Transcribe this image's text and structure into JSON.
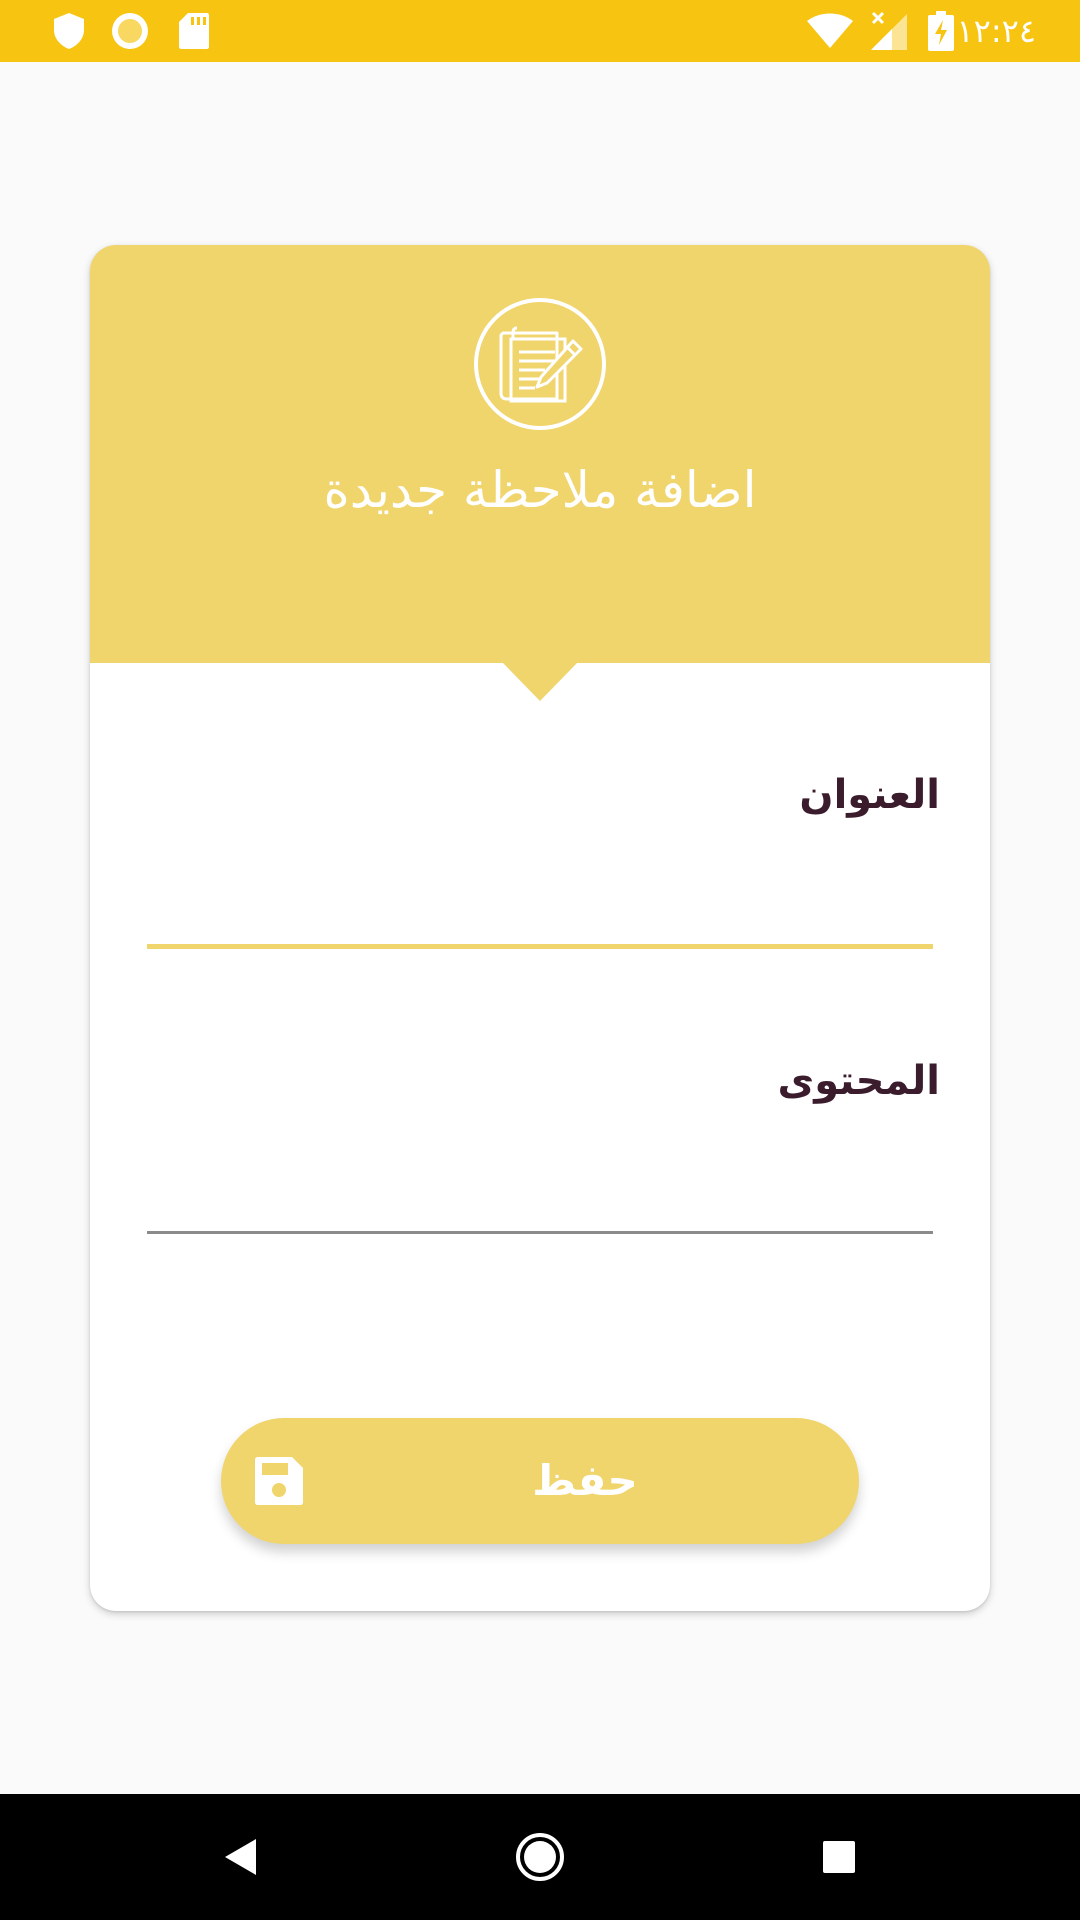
{
  "status_bar": {
    "time": "١٢:٢٤",
    "icons": [
      "shield-icon",
      "sun-icon",
      "sd-card-icon",
      "wifi-icon",
      "signal-icon",
      "battery-charging-icon"
    ]
  },
  "header": {
    "icon": "note-edit-icon",
    "title": "اضافة ملاحظة جديدة"
  },
  "form": {
    "title_label": "العنوان",
    "title_value": "",
    "content_label": "المحتوى",
    "content_value": ""
  },
  "save_button": {
    "label": "حفظ",
    "icon": "floppy-disk-icon"
  },
  "nav": {
    "back": "back-icon",
    "home": "home-icon",
    "recents": "recents-icon"
  },
  "colors": {
    "status_bar": "#f6c411",
    "accent": "#f0d46c",
    "label_text": "#3a1c2c",
    "background": "#fafafa"
  }
}
